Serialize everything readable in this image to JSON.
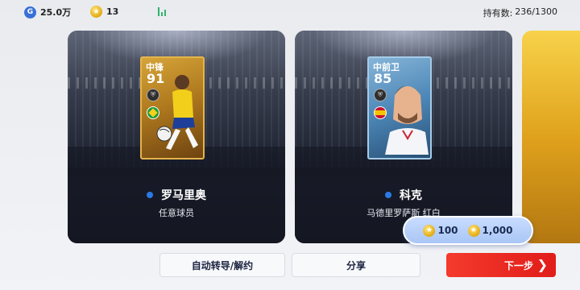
{
  "topbar": {
    "gp_icon_letter": "G",
    "gp": "25.0万",
    "coins": "13",
    "owned_label": "持有数:",
    "owned_value": "236/1300"
  },
  "players": [
    {
      "position": "中锋",
      "rating": "91",
      "name": "罗马里奥",
      "subtitle": "任意球员",
      "nation": "brazil-flag-icon",
      "card_color": "#d6a43a"
    },
    {
      "position": "中前卫",
      "rating": "85",
      "name": "科克",
      "subtitle": "马德里罗萨斯 红白",
      "nation": "spain-flag-icon",
      "card_color": "#4c86b6"
    }
  ],
  "price": {
    "coin_a": "100",
    "coin_b": "1,000"
  },
  "buttons": {
    "auto_transfer": "自动转导/解约",
    "share": "分享",
    "next": "下一步",
    "next_chevron": "❯"
  },
  "colors": {
    "accent_red": "#e11d19",
    "accent_blue_dot": "#2a79e8",
    "price_bubble": "#a9c6f5",
    "gold": "#f7d24a"
  }
}
